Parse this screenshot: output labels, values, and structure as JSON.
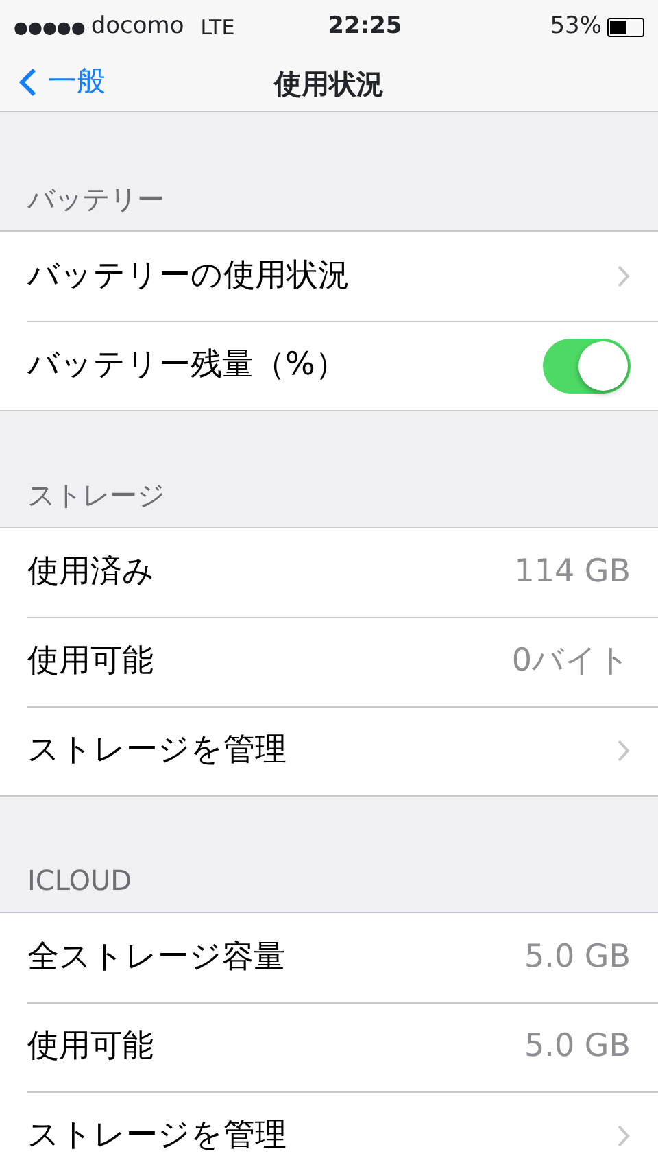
{
  "status_bar": {
    "signal": "●●●●●",
    "carrier": "docomo",
    "network": "LTE",
    "time": "22:25",
    "battery": "53%"
  },
  "nav": {
    "back": "一般",
    "title": "使用状況"
  },
  "sections": [
    {
      "header": "バッテリー",
      "rows": [
        {
          "kind": "disclosure",
          "label": "バッテリーの使用状況"
        },
        {
          "kind": "toggle",
          "label": "バッテリー残量（%）",
          "on": true
        }
      ]
    },
    {
      "header": "ストレージ",
      "rows": [
        {
          "kind": "value",
          "label": "使用済み",
          "value": "114 GB"
        },
        {
          "kind": "value",
          "label": "使用可能",
          "value": "0バイト"
        },
        {
          "kind": "disclosure",
          "label": "ストレージを管理"
        }
      ]
    },
    {
      "header": "ICLOUD",
      "rows": [
        {
          "kind": "value",
          "label": "全ストレージ容量",
          "value": "5.0 GB"
        },
        {
          "kind": "value",
          "label": "使用可能",
          "value": "5.0 GB"
        },
        {
          "kind": "disclosure",
          "label": "ストレージを管理"
        }
      ]
    }
  ]
}
